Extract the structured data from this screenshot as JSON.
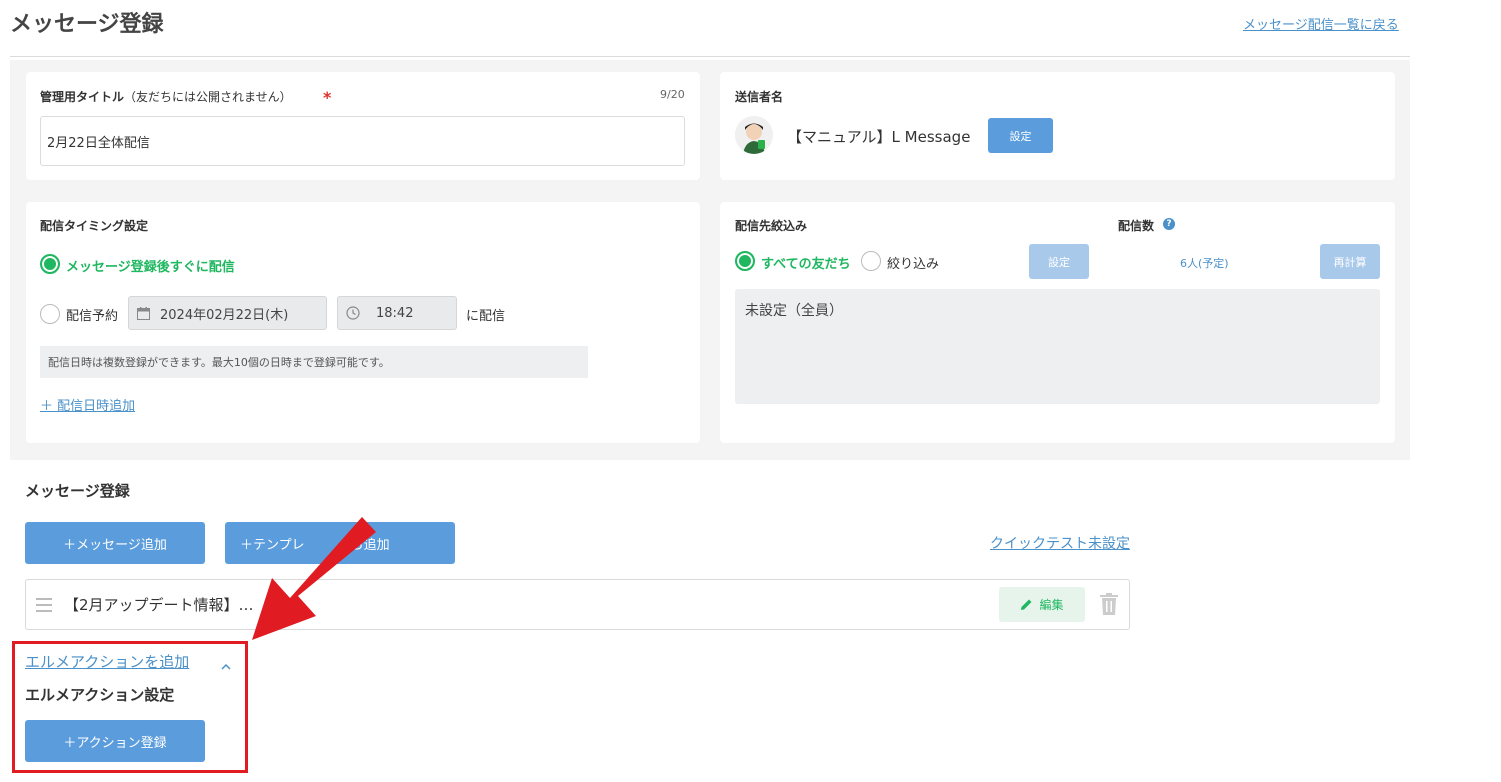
{
  "header": {
    "title": "メッセージ登録",
    "back_link": "メッセージ配信一覧に戻る"
  },
  "admin_title": {
    "label": "管理用タイトル",
    "sub_label": "（友だちには公開されません）",
    "required_mark": "*",
    "counter": "9/20",
    "value": "2月22日全体配信"
  },
  "sender": {
    "label": "送信者名",
    "name": "【マニュアル】L Message",
    "set_button": "設定"
  },
  "timing": {
    "label": "配信タイミング設定",
    "option_immediate": "メッセージ登録後すぐに配信",
    "option_scheduled": "配信予約",
    "date_value": "2024年02月22日(木)",
    "time_value": "18:42",
    "suffix": "に配信",
    "notice": "配信日時は複数登録ができます。最大10個の日時まで登録可能です。",
    "add_link": "＋ 配信日時追加"
  },
  "target": {
    "label": "配信先絞込み",
    "option_all": "すべての友だち",
    "option_filter": "絞り込み",
    "set_button": "設定",
    "count_label": "配信数",
    "help_icon": "?",
    "count_value": "6人(予定)",
    "recalc_button": "再計算",
    "summary": "未設定（全員）"
  },
  "message_section": {
    "heading": "メッセージ登録",
    "add_message_button": "＋メッセージ追加",
    "add_template_button_a": "＋テンプレ",
    "add_template_button_b": "ら追加",
    "quick_test_link": "クイックテスト未設定",
    "item_title": "【2月アップデート情報】…",
    "edit_button": "編集"
  },
  "action_section": {
    "add_link": "エルメアクションを追加",
    "heading": "エルメアクション設定",
    "register_button": "＋アクション登録"
  },
  "colors": {
    "accent_blue": "#5b9ddc",
    "green": "#1fb760",
    "highlight_red": "#e01b22"
  }
}
